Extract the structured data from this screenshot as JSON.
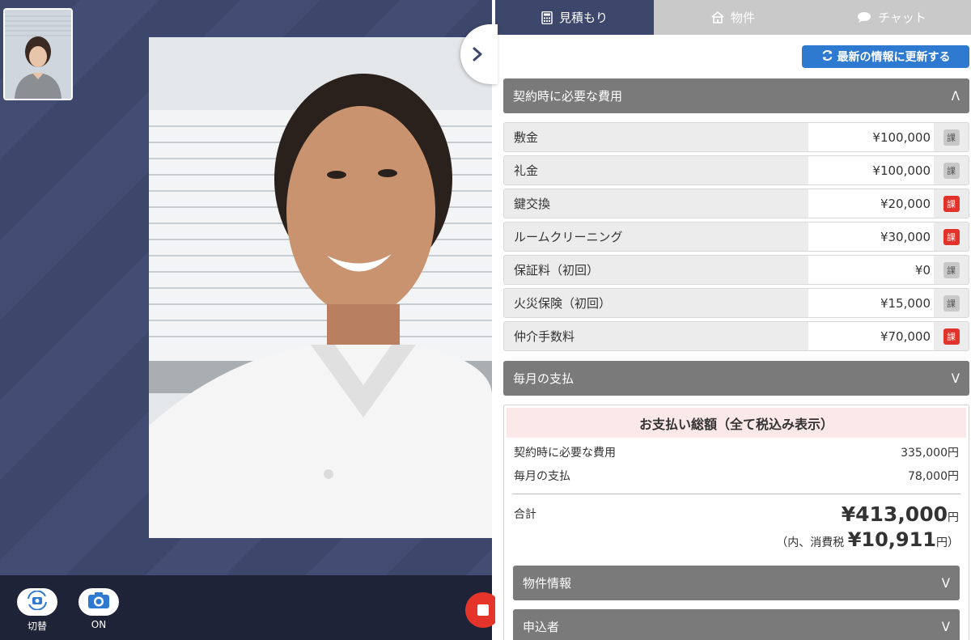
{
  "video": {
    "controls": [
      {
        "name": "switch",
        "label": "切替",
        "icon": "camera-switch-icon"
      },
      {
        "name": "camera",
        "label": "ON",
        "icon": "camera-icon"
      }
    ],
    "collapse_icon": "chevron-right-icon",
    "end_call_icon": "stop-icon"
  },
  "tabs": [
    {
      "label": "見積もり",
      "icon": "calculator-icon",
      "active": true
    },
    {
      "label": "物件",
      "icon": "home-icon",
      "active": false
    },
    {
      "label": "チャット",
      "icon": "speech-bubble-icon",
      "active": false
    }
  ],
  "refresh_button": {
    "label": "最新の情報に更新する",
    "icon": "refresh-icon"
  },
  "contract_section": {
    "title": "契約時に必要な費用",
    "chevron": "ᐱ",
    "fees": [
      {
        "name": "敷金",
        "amount": "¥100,000",
        "tax_label": "課",
        "taxed": false
      },
      {
        "name": "礼金",
        "amount": "¥100,000",
        "tax_label": "課",
        "taxed": false
      },
      {
        "name": "鍵交換",
        "amount": "¥20,000",
        "tax_label": "課",
        "taxed": true
      },
      {
        "name": "ルームクリーニング",
        "amount": "¥30,000",
        "tax_label": "課",
        "taxed": true
      },
      {
        "name": "保証料（初回）",
        "amount": "¥0",
        "tax_label": "課",
        "taxed": false
      },
      {
        "name": "火災保険（初回）",
        "amount": "¥15,000",
        "tax_label": "課",
        "taxed": false
      },
      {
        "name": "仲介手数料",
        "amount": "¥70,000",
        "tax_label": "課",
        "taxed": true
      }
    ]
  },
  "monthly_section": {
    "title": "毎月の支払",
    "chevron": "ᐯ"
  },
  "summary": {
    "title": "お支払い総額（全て税込み表示）",
    "lines": [
      {
        "label": "契約時に必要な費用",
        "value": "335,000円"
      },
      {
        "label": "毎月の支払",
        "value": "78,000円"
      }
    ],
    "total_label": "合計",
    "total_value": "¥413,000",
    "total_unit": "円",
    "tax_prefix": "（内、消費税",
    "tax_value": "¥10,911",
    "tax_suffix": "円）"
  },
  "sub_sections": [
    {
      "title": "物件情報",
      "chevron": "ᐯ"
    },
    {
      "title": "申込者",
      "chevron": "ᐯ"
    }
  ],
  "colors": {
    "navy": "#3d466b",
    "accent_blue": "#2f7ad1",
    "tax_red": "#e2322a",
    "end_call_red": "#e5352b"
  }
}
